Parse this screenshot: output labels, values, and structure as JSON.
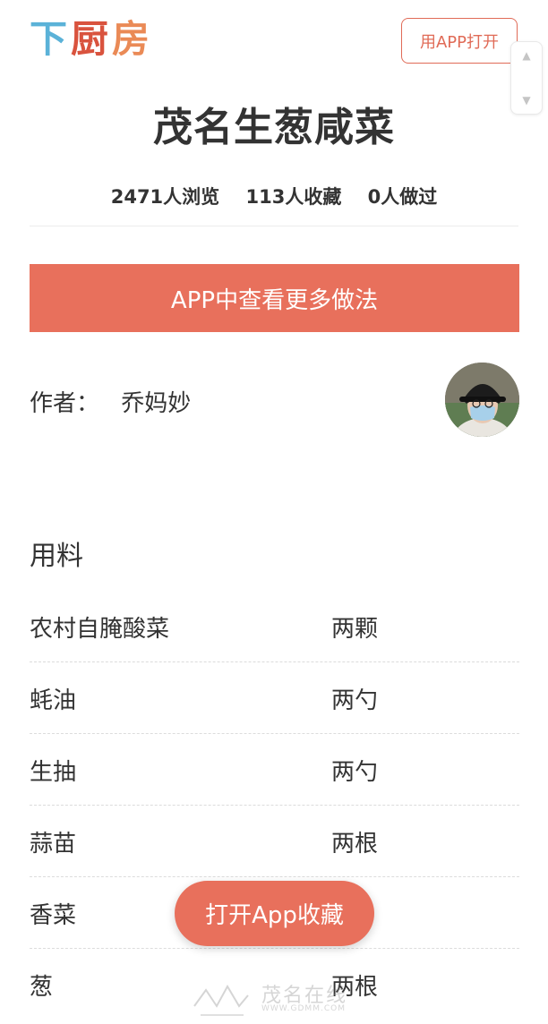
{
  "header": {
    "logo_text": "下厨房",
    "open_app_label": "用APP打开",
    "colors": {
      "logo_blue": "#5bb2d8",
      "logo_red": "#d9533e",
      "logo_orange": "#ea8a56",
      "accent": "#e8705c"
    }
  },
  "scroll_widget": {
    "up_icon": "▲",
    "down_icon": "▼"
  },
  "recipe": {
    "title": "茂名生葱咸菜",
    "stats": {
      "views": "2471人浏览",
      "favorites": "113人收藏",
      "cooked": "0人做过"
    },
    "more_methods_label": "APP中查看更多做法",
    "author_label": "作者：",
    "author_name": "乔妈妙"
  },
  "ingredients": {
    "heading": "用料",
    "items": [
      {
        "name": "农村自腌酸菜",
        "amount": "两颗"
      },
      {
        "name": "蚝油",
        "amount": "两勺"
      },
      {
        "name": "生抽",
        "amount": "两勺"
      },
      {
        "name": "蒜苗",
        "amount": "两根"
      },
      {
        "name": "香菜",
        "amount": ""
      },
      {
        "name": "葱",
        "amount": "两根"
      }
    ]
  },
  "fab": {
    "label": "打开App收藏"
  },
  "watermark": {
    "main": "茂名在线",
    "sub": "WWW.GDMM.COM"
  }
}
